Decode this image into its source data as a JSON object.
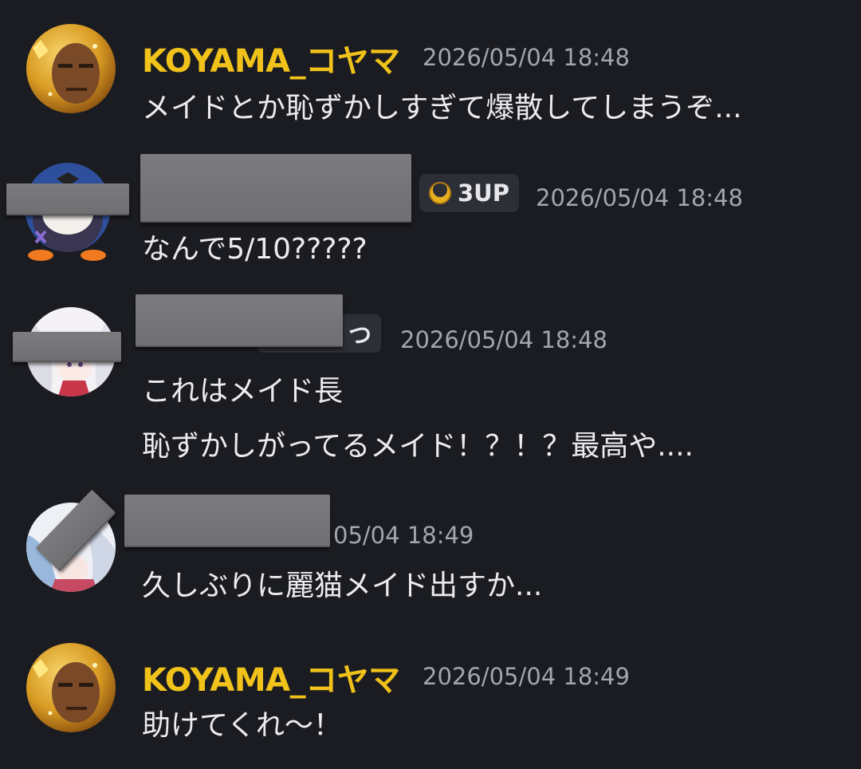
{
  "messages": [
    {
      "author": "KOYAMA_コヤマ",
      "timestamp": "2026/05/04 18:48",
      "lines": [
        "メイドとか恥ずかしすぎて爆散してしまうぞ..."
      ]
    },
    {
      "author": "",
      "badge": "3UP",
      "timestamp": "2026/05/04 18:48",
      "lines": [
        "なんで5/10?????"
      ]
    },
    {
      "author": "",
      "badge": "つ",
      "timestamp": "2026/05/04 18:48",
      "lines": [
        "これはメイド長",
        "恥ずかしがってるメイド！？！？最高や...."
      ]
    },
    {
      "author": "",
      "timestamp": "05/04 18:49",
      "lines": [
        "久しぶりに麗猫メイド出すか..."
      ]
    },
    {
      "author": "KOYAMA_コヤマ",
      "timestamp": "2026/05/04 18:49",
      "lines": [
        "助けてくれ〜！"
      ]
    }
  ],
  "colors": {
    "background": "#1b1c21",
    "username": "#f0c21a",
    "timestamp": "#a2a6ae",
    "message_text": "#ececf0",
    "badge_background": "#2d2f36",
    "redaction": "#747476"
  },
  "icons": {
    "badge_icon": "golden-crescent-icon"
  }
}
